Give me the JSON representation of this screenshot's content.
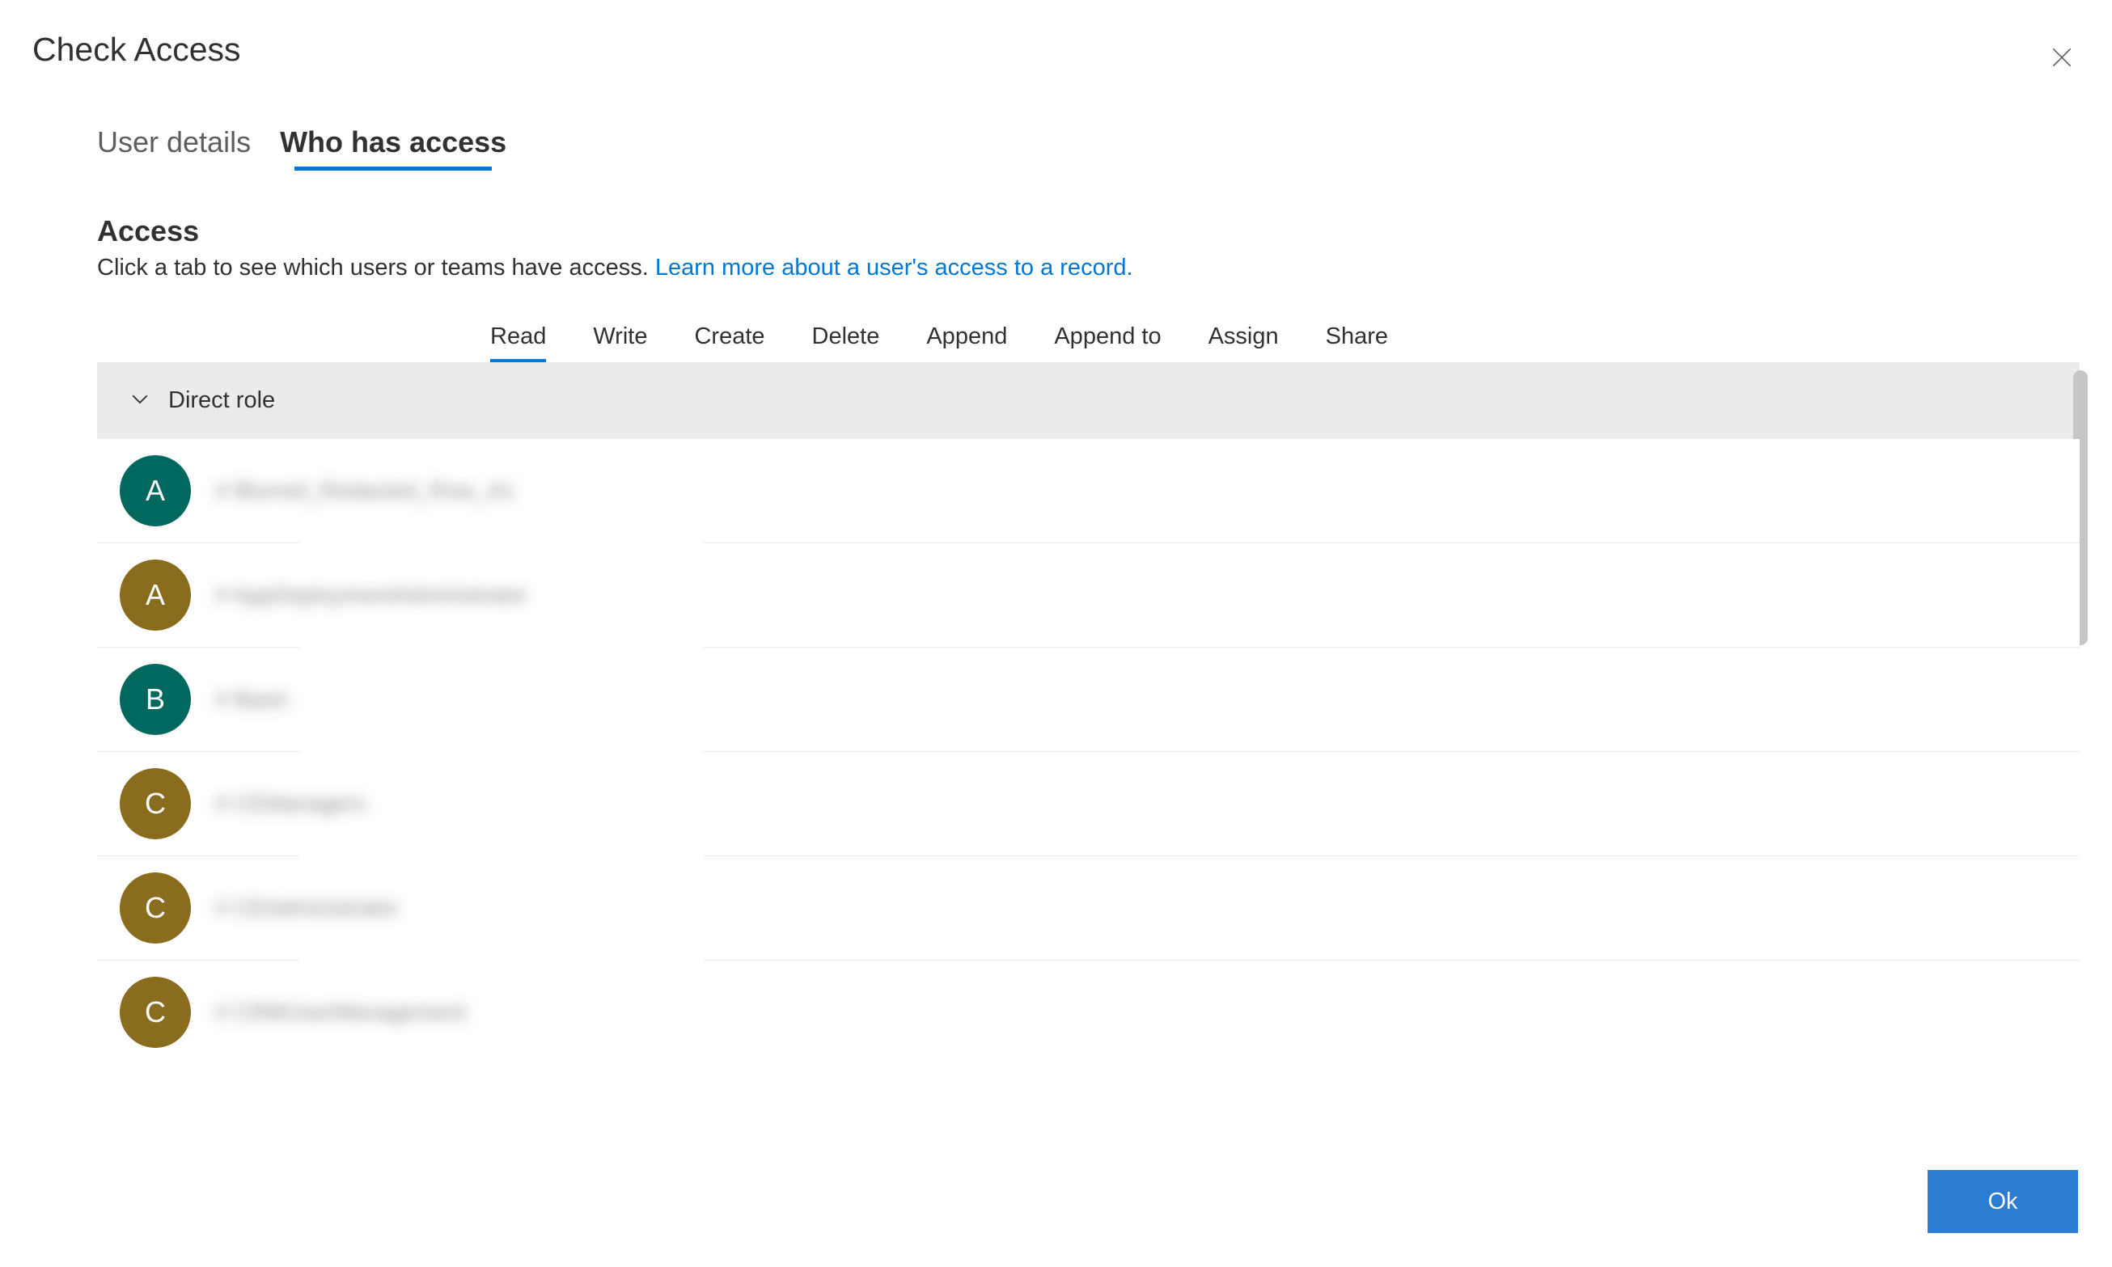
{
  "dialog": {
    "title": "Check Access",
    "close_label": "Close",
    "ok_label": "Ok"
  },
  "primary_tabs": [
    {
      "label": "User details",
      "active": false
    },
    {
      "label": "Who has access",
      "active": true
    }
  ],
  "section": {
    "title": "Access",
    "description_pre": "Click a tab to see which users or teams have access. ",
    "learn_more": "Learn more about a user's access to a record."
  },
  "perm_tabs": [
    {
      "label": "Read",
      "active": true
    },
    {
      "label": "Write",
      "active": false
    },
    {
      "label": "Create",
      "active": false
    },
    {
      "label": "Delete",
      "active": false
    },
    {
      "label": "Append",
      "active": false
    },
    {
      "label": "Append to",
      "active": false
    },
    {
      "label": "Assign",
      "active": false
    },
    {
      "label": "Share",
      "active": false
    }
  ],
  "group": {
    "title": "Direct role"
  },
  "rows": [
    {
      "initial": "A",
      "color": "#00685f",
      "label": "# Blurred_Redacted_Row_A1"
    },
    {
      "initial": "A",
      "color": "#8a6c1f",
      "label": "# AppDeploymentAdministrator"
    },
    {
      "initial": "B",
      "color": "#00685f",
      "label": "# Basic"
    },
    {
      "initial": "C",
      "color": "#8a6c1f",
      "label": "# CEManagers"
    },
    {
      "initial": "C",
      "color": "#8a6c1f",
      "label": "# CEAdministrator"
    },
    {
      "initial": "C",
      "color": "#8a6c1f",
      "label": "# CRMUserManagement"
    }
  ]
}
